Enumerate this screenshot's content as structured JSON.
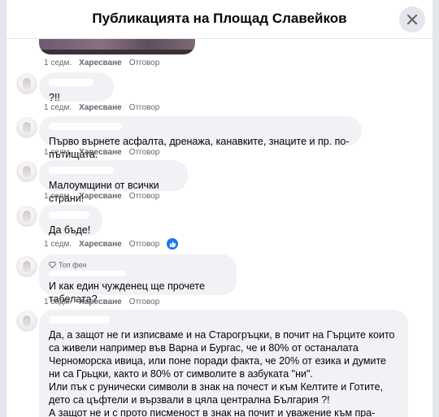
{
  "header": {
    "title": "Публикацията на Площад Славейков",
    "close_icon": "close-icon"
  },
  "labels": {
    "time": "1 седм.",
    "like": "Харесване",
    "reply": "Отговор",
    "top_fan": "Топ фен"
  },
  "comments": [
    {
      "text": "?!!"
    },
    {
      "text": "Първо върнете асфалта, дренажа, канавките, знаците и пр. по-пътищата."
    },
    {
      "text": "Малоумщини от всички страни!"
    },
    {
      "text": "Да бъде!",
      "reaction": "like-reaction-icon"
    },
    {
      "text": "И как един чужденец ще прочете табелата?"
    },
    {
      "text": "Да, а защот не ги изписваме и на Старогръцки, в почит на Гърците които са живели например във Варна и Бургас, че и 80% от останалата Черноморска ивица, или поне поради факта, че 20% от езика и думите ни са Грьцки, както и 80% от символите в азбуката \"ни\".\nИли пък с рунически символи в знак на почест и към Келтите и Готите, дето са цъфтели и вързвали в цяла централна България ?!\nА защот не и с прото писменост в знак на почит и уважение към пра-дедите ни - Траките ?!"
    }
  ],
  "colors": {
    "bubble_bg": "#f0f2f5",
    "accent": "#1877f2",
    "meta_text": "#65676b"
  }
}
